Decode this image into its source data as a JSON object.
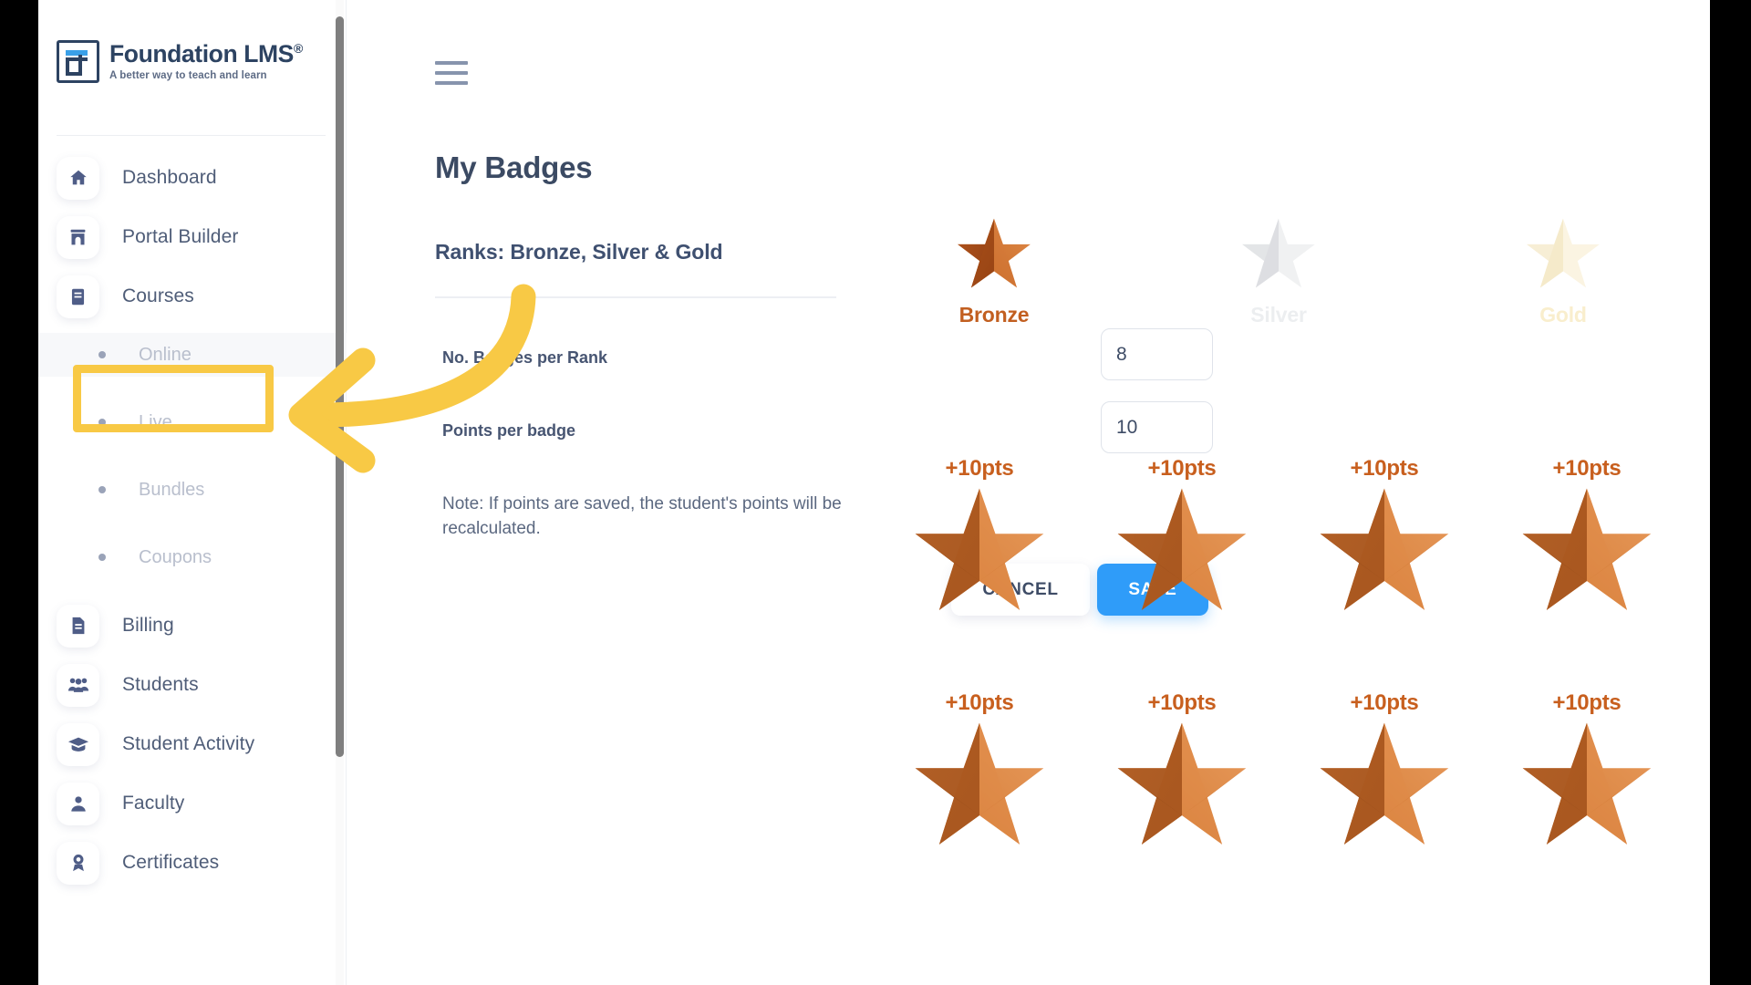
{
  "brand": {
    "name": "Foundation LMS",
    "registered_mark": "®",
    "tagline": "A better way to teach and learn",
    "logo_icon": "foundation-lms-logo-icon",
    "primary_color": "#2d4362",
    "accent_color": "#3aa0e8"
  },
  "sidebar": {
    "items": [
      {
        "label": "Dashboard",
        "icon": "home-icon"
      },
      {
        "label": "Portal Builder",
        "icon": "portal-builder-icon"
      },
      {
        "label": "Courses",
        "icon": "book-icon"
      }
    ],
    "sub_items": [
      {
        "label": "Online",
        "icon": "bullet-dot-icon",
        "active": true
      },
      {
        "label": "Live",
        "icon": "bullet-dot-icon",
        "active": false
      },
      {
        "label": "Bundles",
        "icon": "bullet-dot-icon",
        "active": false
      },
      {
        "label": "Coupons",
        "icon": "bullet-dot-icon",
        "active": false
      }
    ],
    "items_after": [
      {
        "label": "Billing",
        "icon": "invoice-icon"
      },
      {
        "label": "Students",
        "icon": "students-group-icon"
      },
      {
        "label": "Student Activity",
        "icon": "graduation-cap-icon"
      },
      {
        "label": "Faculty",
        "icon": "faculty-person-icon"
      },
      {
        "label": "Certificates",
        "icon": "certificate-ribbon-icon"
      }
    ]
  },
  "topbar": {
    "menu_icon": "hamburger-menu-icon"
  },
  "main": {
    "title": "My Badges",
    "subtitle": "Ranks: Bronze, Silver & Gold",
    "fields": [
      {
        "label": "No. Badges per Rank",
        "value": "8"
      },
      {
        "label": "Points per badge",
        "value": "10"
      }
    ],
    "note": "Note: If points are saved, the student's points will be recalculated.",
    "cancel_label": "CANCEL",
    "save_label": "SAVE",
    "save_color": "#2f9cf9"
  },
  "ranks": [
    {
      "name": "Bronze",
      "color": "#c25f20",
      "state": "earned"
    },
    {
      "name": "Silver",
      "color": "#d9dbdd",
      "state": "locked"
    },
    {
      "name": "Gold",
      "color": "#f5e6bd",
      "state": "locked"
    }
  ],
  "badges": [
    {
      "points_label": "+10pts"
    },
    {
      "points_label": "+10pts"
    },
    {
      "points_label": "+10pts"
    },
    {
      "points_label": "+10pts"
    },
    {
      "points_label": "+10pts"
    },
    {
      "points_label": "+10pts"
    },
    {
      "points_label": "+10pts"
    },
    {
      "points_label": "+10pts"
    }
  ],
  "annotation": {
    "highlight_color": "#f8c945",
    "arrow_color": "#f8c945",
    "highlight_target": "Online"
  }
}
